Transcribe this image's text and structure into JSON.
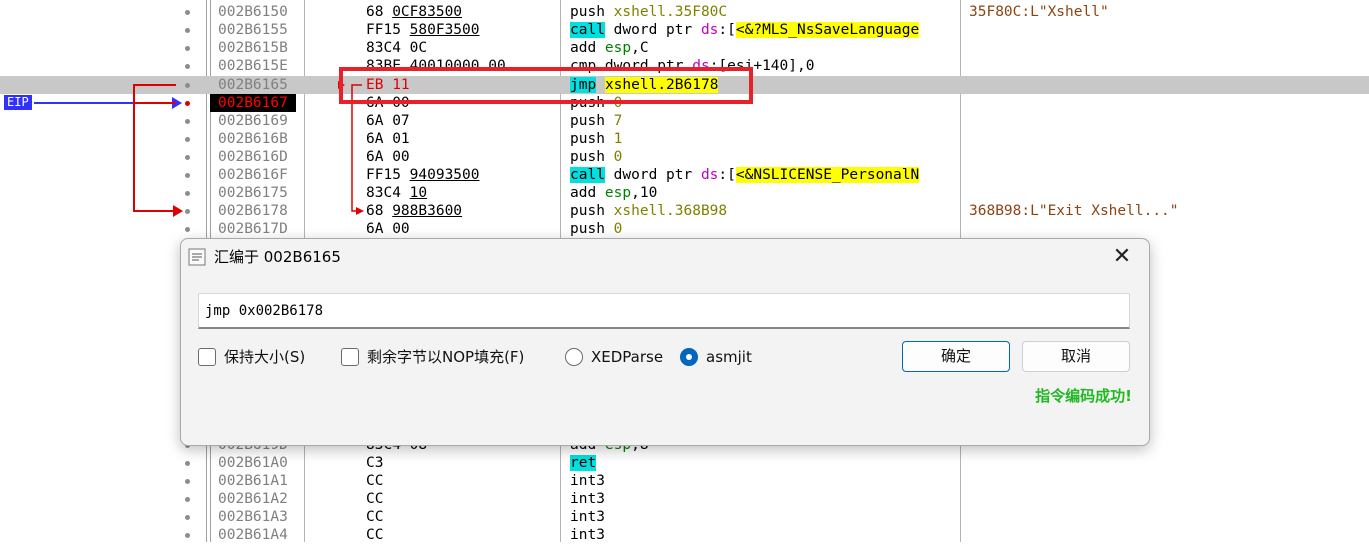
{
  "disassembly": {
    "eip_label": "EIP",
    "rows": [
      {
        "addr": "002B6150",
        "bytes_pre": "68 ",
        "bytes_u": "0CF83500",
        "dis": [
          {
            "t": "push ",
            "c": ""
          },
          {
            "t": "xshell.35F80C",
            "c": "num"
          }
        ],
        "comment": "35F80C:L\"Xshell\""
      },
      {
        "addr": "002B6155",
        "bytes_pre": "FF15 ",
        "bytes_u": "580F3500",
        "dis": [
          {
            "t": "call",
            "c": "hl-cyan"
          },
          {
            "t": " dword ptr ",
            "c": ""
          },
          {
            "t": "ds",
            "c": "ds"
          },
          {
            "t": ":[",
            "c": ""
          },
          {
            "t": "<&?MLS_NsSaveLanguage",
            "c": "hl-yel"
          }
        ],
        "comment": ""
      },
      {
        "addr": "002B615B",
        "bytes_pre": "83C4 0C",
        "bytes_u": "",
        "dis": [
          {
            "t": "add ",
            "c": ""
          },
          {
            "t": "esp",
            "c": "reg"
          },
          {
            "t": ",C",
            "c": ""
          }
        ],
        "comment": ""
      },
      {
        "addr": "002B615E",
        "bytes_pre": "83BE 40010000 00",
        "bytes_u": "",
        "dis": [
          {
            "t": "cmp dword ptr ",
            "c": ""
          },
          {
            "t": "ds",
            "c": "ds"
          },
          {
            "t": ":[esi+140],0",
            "c": ""
          }
        ],
        "comment": ""
      },
      {
        "addr": "002B6165",
        "bytes_pre": "EB 11",
        "bytes_u": "",
        "red": true,
        "current": true,
        "dis": [
          {
            "t": "jmp",
            "c": "hl-cyan"
          },
          {
            "t": " ",
            "c": ""
          },
          {
            "t": "xshell.2B6178",
            "c": "hl-yel"
          }
        ],
        "comment": ""
      },
      {
        "addr": "002B6167",
        "bytes_pre": "6A 00",
        "bytes_u": "",
        "eip": true,
        "dis": [
          {
            "t": "push ",
            "c": ""
          },
          {
            "t": "0",
            "c": "num"
          }
        ],
        "comment": ""
      },
      {
        "addr": "002B6169",
        "bytes_pre": "6A 07",
        "bytes_u": "",
        "dis": [
          {
            "t": "push ",
            "c": ""
          },
          {
            "t": "7",
            "c": "num"
          }
        ],
        "comment": ""
      },
      {
        "addr": "002B616B",
        "bytes_pre": "6A 01",
        "bytes_u": "",
        "dis": [
          {
            "t": "push ",
            "c": ""
          },
          {
            "t": "1",
            "c": "num"
          }
        ],
        "comment": ""
      },
      {
        "addr": "002B616D",
        "bytes_pre": "6A 00",
        "bytes_u": "",
        "dis": [
          {
            "t": "push ",
            "c": ""
          },
          {
            "t": "0",
            "c": "num"
          }
        ],
        "comment": ""
      },
      {
        "addr": "002B616F",
        "bytes_pre": "FF15 ",
        "bytes_u": "94093500",
        "dis": [
          {
            "t": "call",
            "c": "hl-cyan"
          },
          {
            "t": " dword ptr ",
            "c": ""
          },
          {
            "t": "ds",
            "c": "ds"
          },
          {
            "t": ":[",
            "c": ""
          },
          {
            "t": "<&NSLICENSE_PersonalN",
            "c": "hl-yel"
          }
        ],
        "comment": ""
      },
      {
        "addr": "002B6175",
        "bytes_pre": "83C4 ",
        "bytes_u": "10",
        "dis": [
          {
            "t": "add ",
            "c": ""
          },
          {
            "t": "esp",
            "c": "reg"
          },
          {
            "t": ",10",
            "c": ""
          }
        ],
        "comment": ""
      },
      {
        "addr": "002B6178",
        "bytes_pre": "68 ",
        "bytes_u": "988B3600",
        "dis": [
          {
            "t": "push ",
            "c": ""
          },
          {
            "t": "xshell.368B98",
            "c": "num"
          }
        ],
        "comment": "368B98:L\"Exit Xshell...\""
      },
      {
        "addr": "002B617D",
        "bytes_pre": "6A 00",
        "bytes_u": "",
        "dis": [
          {
            "t": "push ",
            "c": ""
          },
          {
            "t": "0",
            "c": "num"
          }
        ],
        "comment": ""
      },
      {
        "addr": "002B619D",
        "bytes_pre": "83C4 08",
        "bytes_u": "",
        "dis": [
          {
            "t": "add ",
            "c": ""
          },
          {
            "t": "esp",
            "c": "reg"
          },
          {
            "t": ",8",
            "c": ""
          }
        ],
        "comment": ""
      },
      {
        "addr": "002B61A0",
        "bytes_pre": "C3",
        "bytes_u": "",
        "dis": [
          {
            "t": "ret",
            "c": "hl-cyan"
          }
        ],
        "comment": ""
      },
      {
        "addr": "002B61A1",
        "bytes_pre": "CC",
        "bytes_u": "",
        "dis": [
          {
            "t": "int3",
            "c": ""
          }
        ],
        "comment": ""
      },
      {
        "addr": "002B61A2",
        "bytes_pre": "CC",
        "bytes_u": "",
        "dis": [
          {
            "t": "int3",
            "c": ""
          }
        ],
        "comment": ""
      },
      {
        "addr": "002B61A3",
        "bytes_pre": "CC",
        "bytes_u": "",
        "dis": [
          {
            "t": "int3",
            "c": ""
          }
        ],
        "comment": ""
      },
      {
        "addr": "002B61A4",
        "bytes_pre": "CC",
        "bytes_u": "",
        "dis": [
          {
            "t": "int3",
            "c": ""
          }
        ],
        "comment": ""
      }
    ]
  },
  "dialog": {
    "title": "汇编于 002B6165",
    "close_glyph": "✕",
    "input_value": "jmp 0x002B6178",
    "options": {
      "keep_size": "保持大小(S)",
      "fill_nop": "剩余字节以NOP填充(F)",
      "xedparse": "XEDParse",
      "asmjit": "asmjit"
    },
    "selected_engine": "asmjit",
    "ok_label": "确定",
    "cancel_label": "取消",
    "status": "指令编码成功!"
  },
  "colors": {
    "eip_blue": "#3030ff",
    "jump_red": "#e00000",
    "highlight_box": "#e8202a",
    "status_green": "#22b822",
    "accent": "#0067c0"
  }
}
